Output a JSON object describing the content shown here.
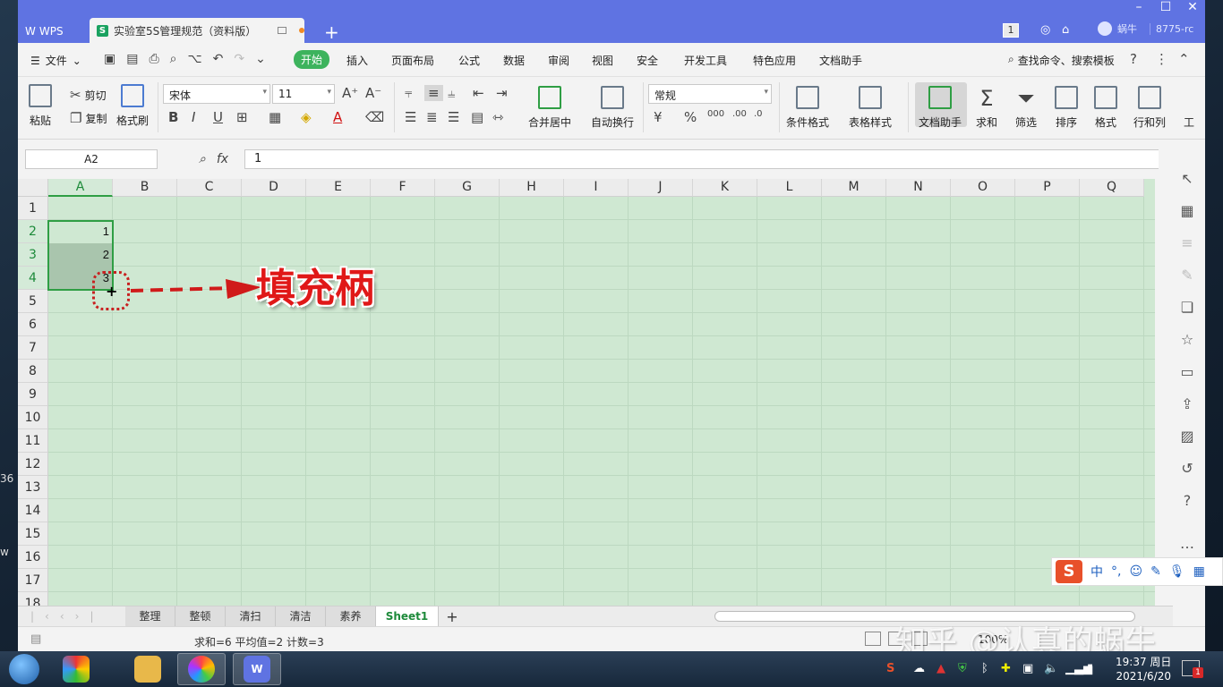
{
  "titlebar": {
    "app_tab": "WPS",
    "doc_tab": "实验室5S管理规范（资料版）",
    "new_tab": "+",
    "badge": "1",
    "user_name": "蜗牛",
    "account": "8775-rc"
  },
  "menu": {
    "file": "文件",
    "items": [
      "开始",
      "插入",
      "页面布局",
      "公式",
      "数据",
      "审阅",
      "视图",
      "安全",
      "开发工具",
      "特色应用",
      "文档助手"
    ],
    "search": "查找命令、搜索模板"
  },
  "ribbon": {
    "cut": "剪切",
    "copy": "复制",
    "paste": "粘贴",
    "format_painter": "格式刷",
    "font_name": "宋体",
    "font_size": "11",
    "merge_center": "合并居中",
    "wrap_text": "自动换行",
    "number_format": "常规",
    "cond_format": "条件格式",
    "table_style": "表格样式",
    "doc_assistant": "文档助手",
    "sum": "求和",
    "filter": "筛选",
    "sort": "排序",
    "format": "格式",
    "rows_cols": "行和列",
    "workbook": "工"
  },
  "formula_bar": {
    "name_box": "A2",
    "fx": "fx",
    "value": "1"
  },
  "grid": {
    "columns": [
      "A",
      "B",
      "C",
      "D",
      "E",
      "F",
      "G",
      "H",
      "I",
      "J",
      "K",
      "L",
      "M",
      "N",
      "O",
      "P",
      "Q"
    ],
    "rows": [
      "1",
      "2",
      "3",
      "4",
      "5",
      "6",
      "7",
      "8",
      "9",
      "10",
      "11",
      "12",
      "13",
      "14",
      "15",
      "16",
      "17",
      "18"
    ],
    "cells": {
      "A2": "1",
      "A3": "2",
      "A4": "3"
    }
  },
  "annotation": "填充柄",
  "sheets": [
    "整理",
    "整顿",
    "清扫",
    "清洁",
    "素养",
    "Sheet1"
  ],
  "active_sheet": "Sheet1",
  "status": {
    "stats": "求和=6  平均值=2  计数=3",
    "zoom": "100%"
  },
  "watermark": "知乎 @认真的蜗牛",
  "ime": {
    "mode": "中",
    "punct": "°,"
  },
  "taskbar": {
    "time": "19:37 周日",
    "date": "2021/6/20",
    "notify_count": "1"
  },
  "desktop_fragments": [
    "36",
    "w"
  ]
}
